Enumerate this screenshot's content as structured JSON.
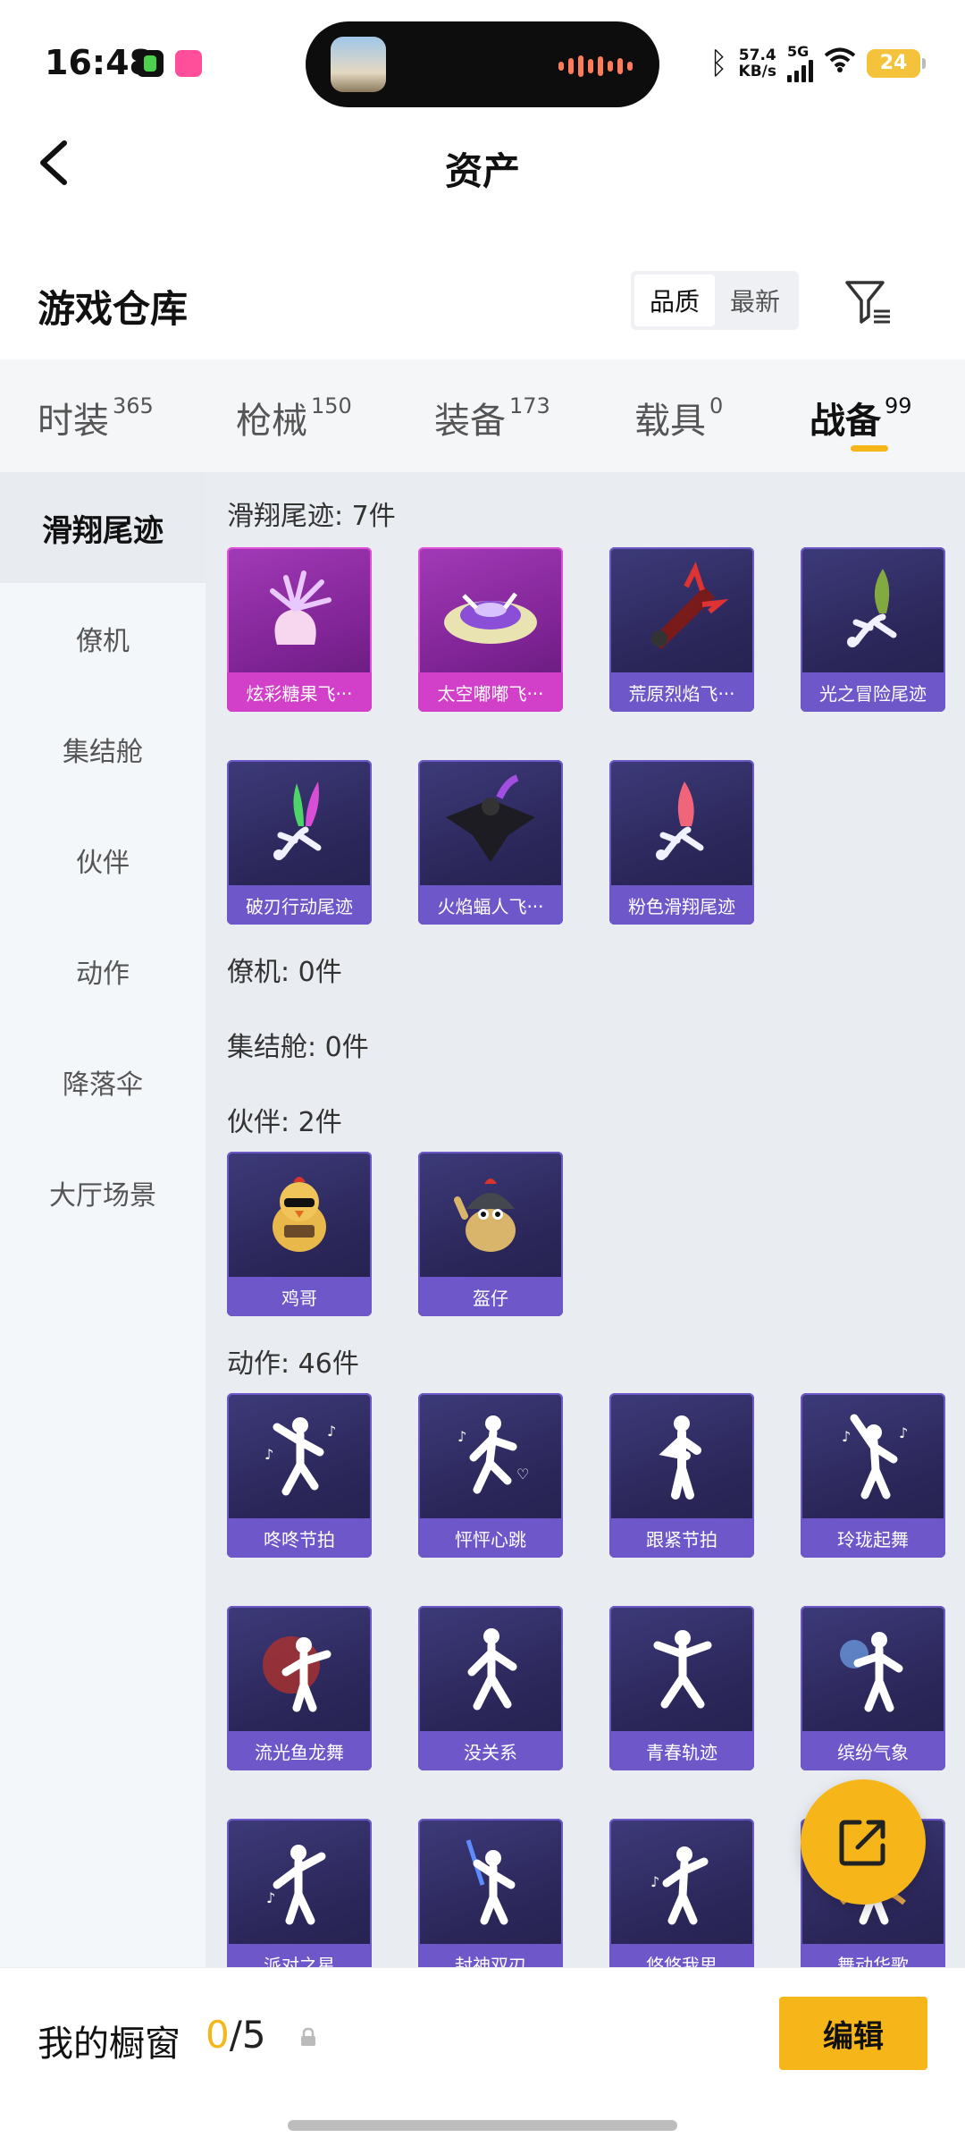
{
  "status_bar": {
    "time": "16:48",
    "net_speed_value": "57.4",
    "net_speed_unit": "KB/s",
    "network": "5G",
    "battery": "24"
  },
  "header": {
    "title": "资产"
  },
  "warehouse": {
    "title": "游戏仓库",
    "sort_options": [
      "品质",
      "最新"
    ]
  },
  "tabs": [
    {
      "label": "时装",
      "count": "365"
    },
    {
      "label": "枪械",
      "count": "150"
    },
    {
      "label": "装备",
      "count": "173"
    },
    {
      "label": "载具",
      "count": "0"
    },
    {
      "label": "战备",
      "count": "99"
    }
  ],
  "categories": [
    "滑翔尾迹",
    "僚机",
    "集结舱",
    "伙伴",
    "动作",
    "降落伞",
    "大厅场景"
  ],
  "sections": {
    "trail_title": "滑翔尾迹: 7件",
    "wingman_title": "僚机: 0件",
    "pod_title": "集结舱: 0件",
    "partner_title": "伙伴: 2件",
    "emote_title": "动作: 46件"
  },
  "trail_items": [
    "炫彩糖果飞···",
    "太空嘟嘟飞···",
    "荒原烈焰飞···",
    "光之冒险尾迹",
    "破刃行动尾迹",
    "火焰蝠人飞···",
    "粉色滑翔尾迹"
  ],
  "partner_items": [
    "鸡哥",
    "盔仔"
  ],
  "emote_items": [
    "咚咚节拍",
    "怦怦心跳",
    "跟紧节拍",
    "玲珑起舞",
    "流光鱼龙舞",
    "没关系",
    "青春轨迹",
    "缤纷气象",
    "派对之星",
    "封神双刃",
    "悠悠我思",
    "舞动华歌"
  ],
  "bottom": {
    "window_label": "我的橱窗",
    "window_used": "0",
    "window_total": "/5",
    "edit_label": "编辑"
  },
  "colors": {
    "accent": "#f6b619",
    "item_bg": "#2a2658",
    "item_label": "#6e58c9",
    "item_pink": "#d23fc9"
  }
}
